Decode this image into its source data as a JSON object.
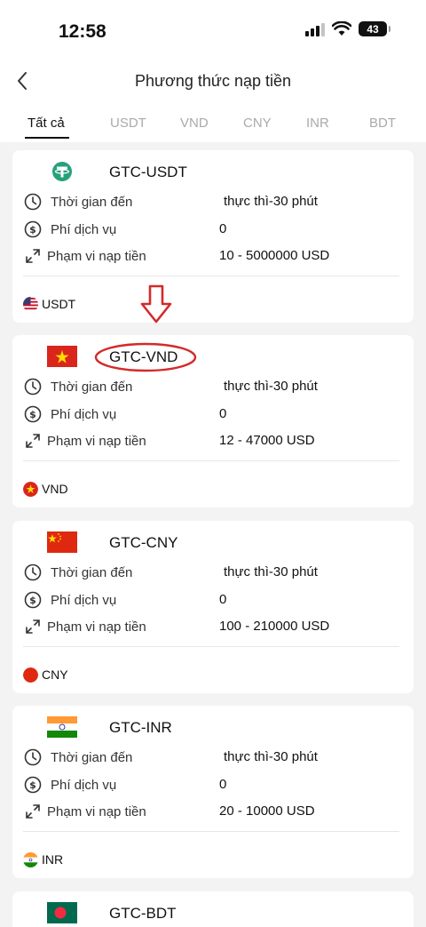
{
  "status": {
    "time": "12:58",
    "battery": "43"
  },
  "nav": {
    "title": "Phương thức nạp tiền"
  },
  "tabs": [
    {
      "label": "Tất cả"
    },
    {
      "label": "USDT"
    },
    {
      "label": "VND"
    },
    {
      "label": "CNY"
    },
    {
      "label": "INR"
    },
    {
      "label": "BDT"
    }
  ],
  "active_tab": "Tất cả",
  "methods": [
    {
      "name": "GTC-USDT",
      "time_label": "Thời gian đến",
      "time_value": "thực thì-30 phút",
      "fee_label": "Phí dịch vụ",
      "fee_value": "0",
      "range_label": "Phạm vi nạp tiền",
      "range_value": "10 - 5000000 USD",
      "currency": "USDT"
    },
    {
      "name": "GTC-VND",
      "time_label": "Thời gian đến",
      "time_value": "thực thì-30 phút",
      "fee_label": "Phí dịch vụ",
      "fee_value": "0",
      "range_label": "Phạm vi nạp tiền",
      "range_value": "12 - 47000 USD",
      "currency": "VND"
    },
    {
      "name": "GTC-CNY",
      "time_label": "Thời gian đến",
      "time_value": "thực thì-30 phút",
      "fee_label": "Phí dịch vụ",
      "fee_value": "0",
      "range_label": "Phạm vi nạp tiền",
      "range_value": "100 - 210000 USD",
      "currency": "CNY"
    },
    {
      "name": "GTC-INR",
      "time_label": "Thời gian đến",
      "time_value": "thực thì-30 phút",
      "fee_label": "Phí dịch vụ",
      "fee_value": "0",
      "range_label": "Phạm vi nạp tiền",
      "range_value": "20 - 10000 USD",
      "currency": "INR"
    },
    {
      "name": "GTC-BDT"
    }
  ],
  "colors": {
    "annotation": "#d42a2a",
    "tether": "#26a17b",
    "vn_red": "#da251d",
    "vn_star": "#ffdd00",
    "cn_red": "#de2910",
    "in_saffron": "#ff9933",
    "in_green": "#138808",
    "bd_green": "#006a4e",
    "bd_red": "#f42a41"
  }
}
